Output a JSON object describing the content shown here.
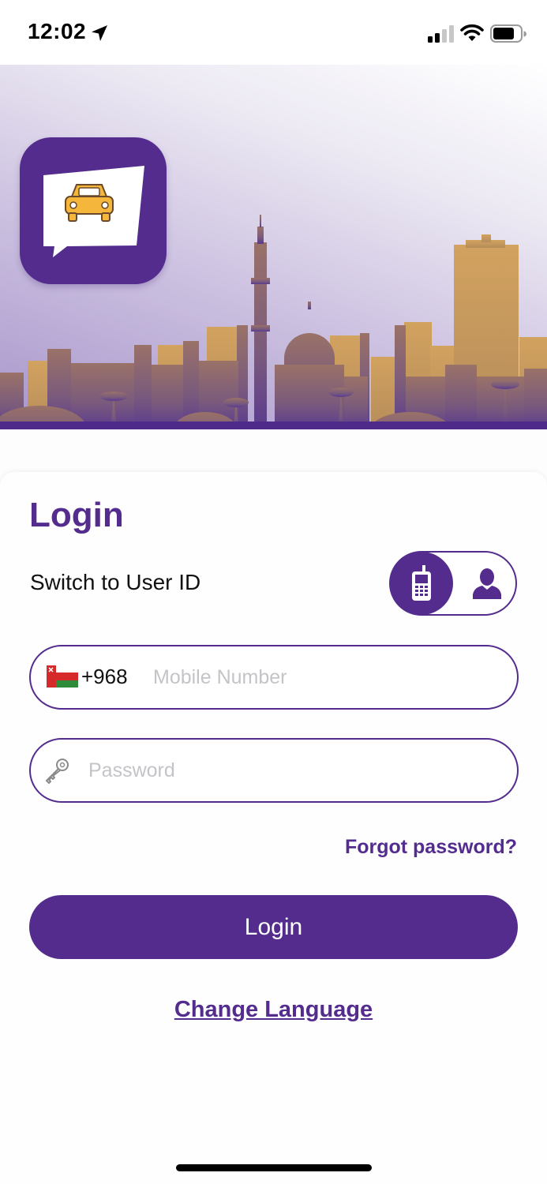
{
  "status_bar": {
    "time": "12:02",
    "location_icon": "location-arrow-icon",
    "signal_icon": "cellular-signal-icon",
    "wifi_icon": "wifi-icon",
    "battery_icon": "battery-icon"
  },
  "hero": {
    "logo_icon": "car-in-chat-bubble-icon",
    "background_icon": "city-skyline-icon"
  },
  "login": {
    "title": "Login",
    "switch_label": "Switch to User ID",
    "toggle": {
      "active": "mobile",
      "mobile_icon": "mobile-phone-icon",
      "user_icon": "user-icon"
    },
    "mobile": {
      "flag_icon": "oman-flag-icon",
      "country_code": "+968",
      "placeholder": "Mobile Number",
      "value": ""
    },
    "password": {
      "icon": "key-icon",
      "placeholder": "Password",
      "value": ""
    },
    "forgot_password": "Forgot password?",
    "submit_label": "Login",
    "change_language": "Change Language"
  },
  "colors": {
    "primary": "#532c8e",
    "accent": "#f5b63c",
    "skyline": "#c49a5c"
  }
}
